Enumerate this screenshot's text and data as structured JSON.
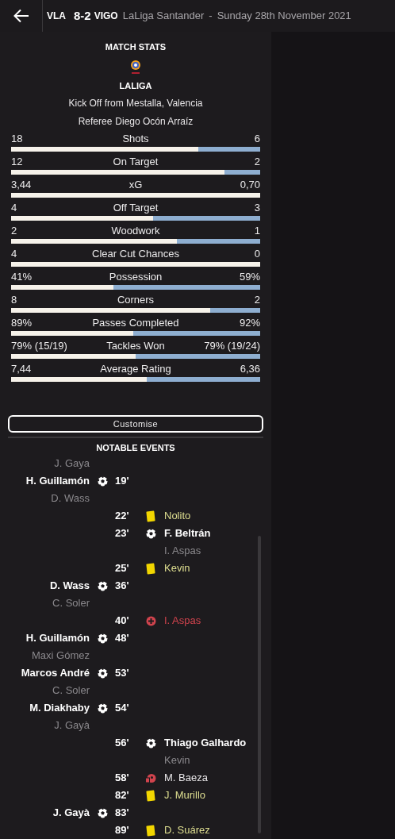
{
  "header": {
    "home": "VLA",
    "score": "8-2",
    "away": "VIGO",
    "competition": "LaLiga Santander",
    "separator": "-",
    "date": "Sunday 28th November 2021"
  },
  "match_stats": {
    "title": "MATCH STATS",
    "competition": "LALIGA",
    "kick_off": "Kick Off from Mestalla, Valencia",
    "referee_label": "Referee",
    "referee": "Diego Ocón Arraíz"
  },
  "stats": [
    {
      "label": "Shots",
      "home": "18",
      "away": "6",
      "level": 0.75
    },
    {
      "label": "On Target",
      "home": "12",
      "away": "2",
      "level": 0.857
    },
    {
      "label": "xG",
      "home": "3,44",
      "away": "0,70",
      "level": 1
    },
    {
      "label": "Off Target",
      "home": "4",
      "away": "3",
      "level": 0.57
    },
    {
      "label": "Woodwork",
      "home": "2",
      "away": "1",
      "level": 0.667
    },
    {
      "label": "Clear Cut Chances",
      "home": "4",
      "away": "0",
      "level": 1
    },
    {
      "label": "Possession",
      "home": "41%",
      "away": "59%",
      "level": 0.41
    },
    {
      "label": "Corners",
      "home": "8",
      "away": "2",
      "level": 0.8
    },
    {
      "label": "Passes Completed",
      "home": "89%",
      "away": "92%",
      "level": 0.49
    },
    {
      "label": "Tackles Won",
      "home": "79% (15/19)",
      "away": "79% (19/24)",
      "level": 0.5
    },
    {
      "label": "Average Rating",
      "home": "7,44",
      "away": "6,36",
      "level": 0.545
    }
  ],
  "customise_button": "Customise",
  "events_title": "NOTABLE EVENTS",
  "events": [
    {
      "is_home": true,
      "kind": "assist",
      "name": "J. Gaya"
    },
    {
      "is_home": true,
      "kind": "goal",
      "name": "H. Guillamón",
      "minute": "19'"
    },
    {
      "is_home": true,
      "kind": "assist",
      "name": "D. Wass"
    },
    {
      "is_home": false,
      "kind": "yellow",
      "name": "Nolito",
      "minute": "22'"
    },
    {
      "is_home": false,
      "kind": "goal",
      "name": "F. Beltrán",
      "minute": "23'"
    },
    {
      "is_home": false,
      "kind": "assist",
      "name": "I. Aspas"
    },
    {
      "is_home": false,
      "kind": "yellow",
      "name": "Kevin",
      "minute": "25'"
    },
    {
      "is_home": true,
      "kind": "goal",
      "name": "D. Wass",
      "minute": "36'"
    },
    {
      "is_home": true,
      "kind": "assist",
      "name": "C. Soler"
    },
    {
      "is_home": false,
      "kind": "injury",
      "name": "I. Aspas",
      "minute": "40'"
    },
    {
      "is_home": true,
      "kind": "goal",
      "name": "H. Guillamón",
      "minute": "48'"
    },
    {
      "is_home": true,
      "kind": "assist",
      "name": "Maxi Gómez"
    },
    {
      "is_home": true,
      "kind": "goal",
      "name": "Marcos André",
      "minute": "53'"
    },
    {
      "is_home": true,
      "kind": "assist",
      "name": "C. Soler"
    },
    {
      "is_home": true,
      "kind": "goal",
      "name": "M. Diakhaby",
      "minute": "54'"
    },
    {
      "is_home": true,
      "kind": "assist",
      "name": "J. Gayà"
    },
    {
      "is_home": false,
      "kind": "goal",
      "name": "Thiago Galhardo",
      "minute": "56'"
    },
    {
      "is_home": false,
      "kind": "assist",
      "name": "Kevin"
    },
    {
      "is_home": false,
      "kind": "missed",
      "name": "M. Baeza",
      "minute": "58'"
    },
    {
      "is_home": false,
      "kind": "yellow",
      "name": "J. Murillo",
      "minute": "82'"
    },
    {
      "is_home": true,
      "kind": "goal",
      "name": "J. Gayà",
      "minute": "83'"
    },
    {
      "is_home": false,
      "kind": "yellow",
      "name": "D. Suárez",
      "minute": "89'"
    }
  ]
}
